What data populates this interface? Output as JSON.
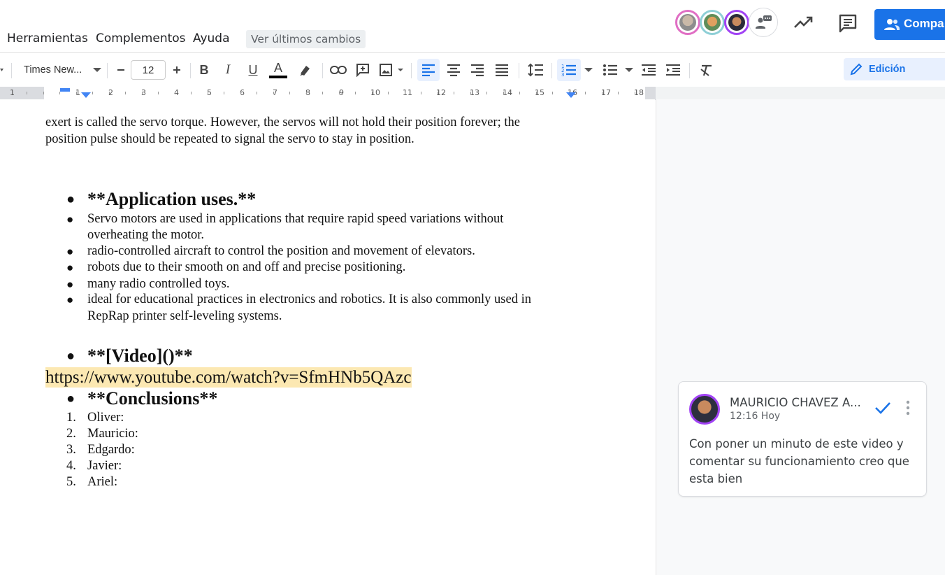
{
  "menubar": {
    "items": [
      "Herramientas",
      "Complementos",
      "Ayuda"
    ],
    "last_changes": "Ver últimos cambios",
    "share_label": "Compa"
  },
  "toolbar": {
    "font": "Times New...",
    "font_size": "12",
    "mode_label": "Edición"
  },
  "ruler": {
    "numbers": [
      "1",
      "1",
      "2",
      "3",
      "4",
      "5",
      "6",
      "7",
      "8",
      "9",
      "10",
      "11",
      "12",
      "13",
      "14",
      "15",
      "16",
      "17",
      "18"
    ]
  },
  "document": {
    "intro_line1": "exert is called the servo torque. However, the servos will not hold their position forever; the",
    "intro_line2": "position pulse should be repeated to signal the servo to stay in position.",
    "heading_apps": "**Application uses.**",
    "app_items": [
      "Servo motors are used in applications that require rapid speed variations without",
      "overheating the motor.",
      "radio-controlled aircraft to control the position and movement of elevators.",
      "robots due to their smooth on and off and precise positioning.",
      "many radio controlled toys.",
      "ideal for educational practices in electronics and robotics. It is also commonly used in",
      "RepRap printer self-leveling systems."
    ],
    "heading_video": "**[Video]()**",
    "video_url": "https://www.youtube.com/watch?v=SfmHNb5QAzc",
    "heading_conclusions": "**Conclusions**",
    "conclusions": [
      {
        "n": "1.",
        "text": "Oliver:"
      },
      {
        "n": "2.",
        "text": "Mauricio:"
      },
      {
        "n": "3.",
        "text": "Edgardo:"
      },
      {
        "n": "4.",
        "text": "Javier:"
      },
      {
        "n": "5.",
        "text": "Ariel:"
      }
    ]
  },
  "comment": {
    "author": "MAURICIO CHAVEZ A...",
    "time": "12:16 Hoy",
    "line1": "Con poner un minuto de este video y",
    "line2": "comentar su funcionamiento creo que",
    "line3": "esta bien"
  },
  "colors": {
    "accent": "#1a73e8",
    "highlight": "#fce8b2",
    "avatar1": "#e06ec4",
    "avatar2": "#8ecfd6",
    "avatar3": "#a142f4"
  }
}
